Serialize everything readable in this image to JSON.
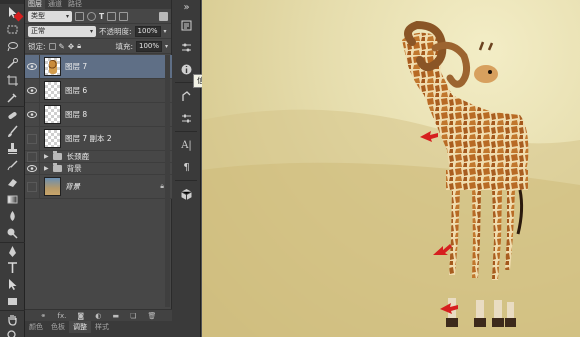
{
  "tools": [
    "move-tool",
    "marquee-tool",
    "lasso-tool",
    "quick-select-tool",
    "crop-tool",
    "eyedropper-tool",
    "healing-brush-tool",
    "brush-tool",
    "clone-stamp-tool",
    "history-brush-tool",
    "eraser-tool",
    "gradient-tool",
    "blur-tool",
    "dodge-tool",
    "pen-tool",
    "type-tool",
    "path-select-tool",
    "shape-tool",
    "hand-tool",
    "zoom-tool"
  ],
  "panel": {
    "tabs": [
      "图层",
      "通道",
      "路径"
    ],
    "filter_kind": "类型",
    "blend_mode": "正常",
    "opacity_label": "不透明度:",
    "opacity_value": "100%",
    "lock_label": "锁定:",
    "fill_label": "填充:",
    "fill_value": "100%",
    "layers": [
      {
        "name": "图层 7"
      },
      {
        "name": "图层 6"
      },
      {
        "name": "图层 8"
      },
      {
        "name": "图层 7 副本 2"
      },
      {
        "name": "长颈鹿"
      },
      {
        "name": "背景"
      },
      {
        "name": "背景"
      }
    ],
    "bottom_tabs": [
      "颜色",
      "色板",
      "调整",
      "样式"
    ],
    "bottom_fx": "fx."
  },
  "dock": {
    "tooltip": "信息"
  },
  "colors": {
    "annotation_red": "#d61f1f",
    "selected_layer": "#5f6f86"
  }
}
